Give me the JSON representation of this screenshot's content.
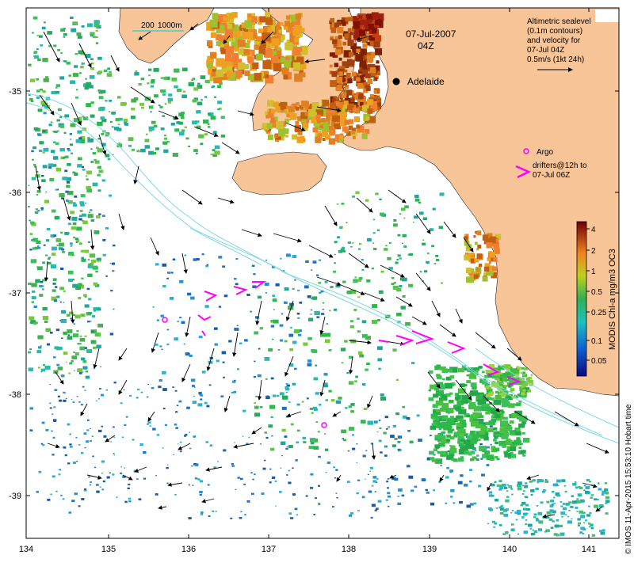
{
  "header": {
    "date": "07-Jul-2007",
    "time": "04Z"
  },
  "scale_bar": {
    "label": "200",
    "label2": "1000m"
  },
  "city": {
    "name": "Adelaide"
  },
  "legend": {
    "line1": "Altimetric sealevel",
    "line2": "(0.1m contours)",
    "line3": "and velocity for",
    "line4": "07-Jul 04Z",
    "line5": "0.5m/s (1kt 24h)",
    "argo_label": "Argo",
    "drifters_line1": "drifters@12h to",
    "drifters_line2": "07-Jul 06Z"
  },
  "colorbar": {
    "title": "MODIS Chl-a mg/m3 OC3",
    "ticks": [
      "4",
      "2",
      "1",
      "0.5",
      "0.25",
      "0.1",
      "0.05"
    ]
  },
  "credit": "© IMOS 11-Apr-2015 15:53:10 Hobart time",
  "axes": {
    "x_ticks": [
      "134",
      "135",
      "136",
      "137",
      "138",
      "139",
      "140",
      "141"
    ],
    "y_ticks": [
      "-35",
      "-36",
      "-37",
      "-38",
      "-39"
    ]
  },
  "colors": {
    "land": "#f8c598",
    "drifter": "#ff00ff",
    "contour": "#7fd8e8"
  }
}
